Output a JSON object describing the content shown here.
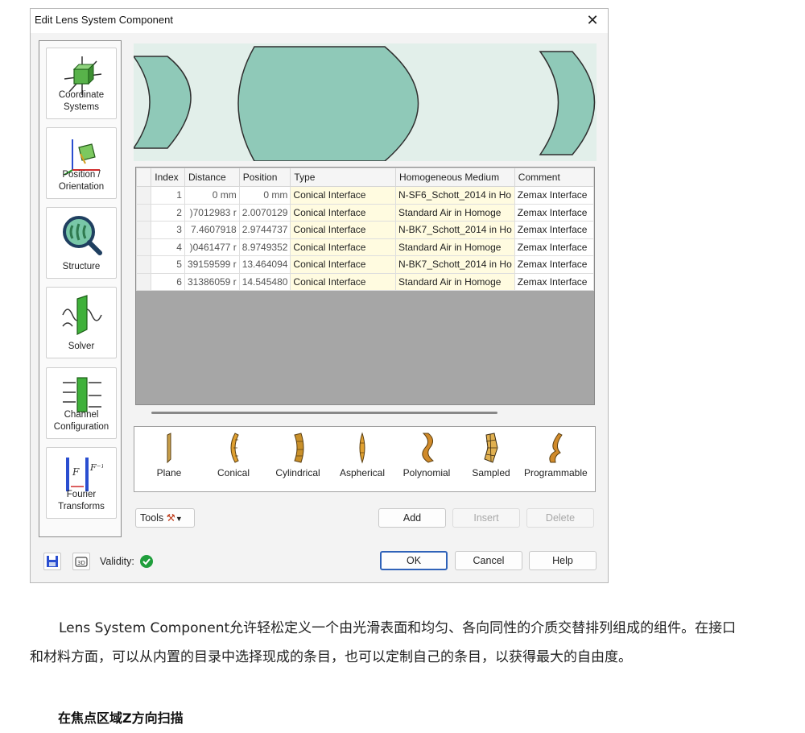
{
  "dialog": {
    "title": "Edit Lens System Component",
    "close_symbol": "✕"
  },
  "sidebar": {
    "items": [
      {
        "label": "Coordinate\nSystems",
        "icon": "coordinate-systems-icon"
      },
      {
        "label": "Position /\nOrientation",
        "icon": "position-orientation-icon"
      },
      {
        "label": "Structure",
        "icon": "structure-icon"
      },
      {
        "label": "Solver",
        "icon": "solver-icon"
      },
      {
        "label": "Channel\nConfiguration",
        "icon": "channel-configuration-icon"
      },
      {
        "label": "Fourier\nTransforms",
        "icon": "fourier-transforms-icon"
      }
    ]
  },
  "table": {
    "columns": [
      "Index",
      "Distance",
      "Position",
      "Type",
      "Homogeneous Medium",
      "Comment"
    ],
    "rows": [
      [
        "1",
        "0 mm",
        "0 mm",
        "Conical Interface",
        "N-SF6_Schott_2014 in Ho",
        "Zemax Interface"
      ],
      [
        "2",
        ")7012983 r",
        "2.0070129",
        "Conical Interface",
        "Standard Air in Homoge",
        "Zemax Interface"
      ],
      [
        "3",
        "7.4607918",
        "2.9744737",
        "Conical Interface",
        "N-BK7_Schott_2014 in Ho",
        "Zemax Interface"
      ],
      [
        "4",
        ")0461477 r",
        "8.9749352",
        "Conical Interface",
        "Standard Air in Homoge",
        "Zemax Interface"
      ],
      [
        "5",
        "39159599 r",
        "13.464094",
        "Conical Interface",
        "N-BK7_Schott_2014 in Ho",
        "Zemax Interface"
      ],
      [
        "6",
        "31386059 r",
        "14.545480",
        "Conical Interface",
        "Standard Air in Homoge",
        "Zemax Interface"
      ]
    ]
  },
  "palette": {
    "items": [
      "Plane",
      "Conical",
      "Cylindrical",
      "Aspherical",
      "Polynomial",
      "Sampled",
      "Programmable"
    ]
  },
  "toolbar": {
    "tools_label": "Tools",
    "add_label": "Add",
    "insert_label": "Insert",
    "delete_label": "Delete"
  },
  "footer": {
    "validity_label": "Validity:",
    "ok_label": "OK",
    "cancel_label": "Cancel",
    "help_label": "Help"
  },
  "article": {
    "paragraph_line1": "Lens System Component允许轻松定义一个由光滑表面和均匀、各向同性的介质交替排列组成的组件。在接口",
    "paragraph_line2": "和材料方面，可以从内置的目录中选择现成的条目，也可以定制自己的条目，以获得最大的自由度。",
    "heading": "在焦点区域Z方向扫描"
  },
  "colors": {
    "lens_fill": "#8fc9b8",
    "lens_stroke": "#2f2f2f",
    "preview_bg": "#e2efea",
    "accent_blue": "#2f62b8",
    "valid_green": "#1f9e3b",
    "type_cell_bg": "#fffbe0"
  }
}
